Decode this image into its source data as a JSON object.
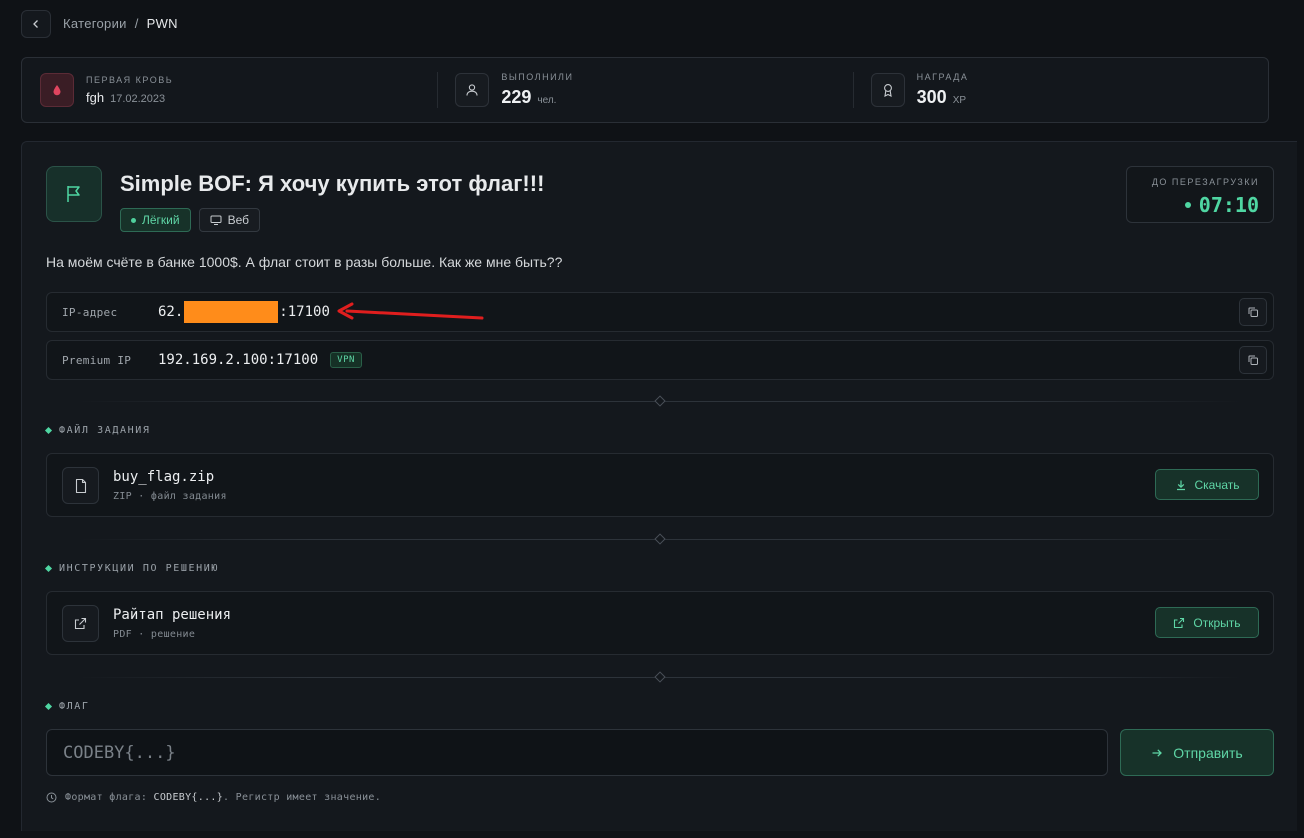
{
  "breadcrumb": {
    "parent": "Категории",
    "separator": "/",
    "current": "PWN"
  },
  "stats": {
    "first_blood": {
      "label": "ПЕРВАЯ КРОВЬ",
      "user": "fgh",
      "date": "17.02.2023"
    },
    "solved": {
      "label": "ВЫПОЛНИЛИ",
      "value": "229",
      "unit": "чел."
    },
    "reward": {
      "label": "НАГРАДА",
      "value": "300",
      "unit": "XP"
    }
  },
  "task": {
    "title": "Simple BOF: Я хочу купить этот флаг!!!",
    "difficulty": "Лёгкий",
    "category": "Веб",
    "description": "На моём счёте в банке 1000$. А флаг стоит в разы больше. Как же мне быть??"
  },
  "timer": {
    "label": "ДО ПЕРЕЗАГРУЗКИ",
    "value": "07:10"
  },
  "connections": {
    "ip": {
      "label": "IP-адрес",
      "prefix": "62.",
      "suffix": ":17100"
    },
    "premium": {
      "label": "Premium IP",
      "value": "192.169.2.100:17100",
      "badge": "VPN"
    }
  },
  "file_section": {
    "label": "ФАЙЛ ЗАДАНИЯ",
    "name": "buy_flag.zip",
    "meta": "ZIP · файл задания",
    "button": "Скачать"
  },
  "writeup_section": {
    "label": "ИНСТРУКЦИИ ПО РЕШЕНИЮ",
    "name": "Райтап решения",
    "meta": "PDF · решение",
    "button": "Открыть"
  },
  "flag_section": {
    "label": "ФЛАГ",
    "placeholder": "CODEBY{...}",
    "button": "Отправить",
    "hint_prefix": "Формат флага:",
    "hint_code": "CODEBY{...}",
    "hint_suffix": ". Регистр имеет значение."
  },
  "colors": {
    "accent": "#4fd6a2",
    "mask": "#ff8c1a",
    "arrow": "#e01e1e",
    "blood": "#e0455f"
  }
}
